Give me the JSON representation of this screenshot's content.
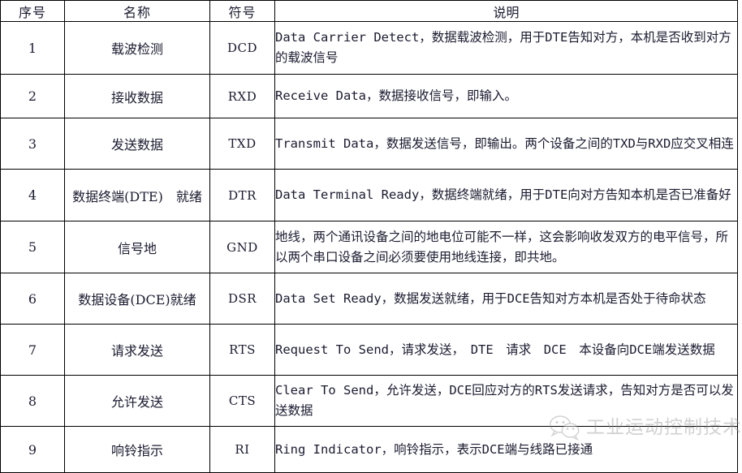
{
  "table": {
    "headers": {
      "seq": "序号",
      "name": "名称",
      "symbol": "符号",
      "description": "说明"
    },
    "rows": [
      {
        "seq": "1",
        "name": "载波检测",
        "symbol": "DCD",
        "description": "Data Carrier Detect，数据载波检测，用于DTE告知对方，本机是否收到对方的载波信号"
      },
      {
        "seq": "2",
        "name": "接收数据",
        "symbol": "RXD",
        "description": "Receive Data，数据接收信号，即输入。"
      },
      {
        "seq": "3",
        "name": "发送数据",
        "symbol": "TXD",
        "description": "Transmit Data，数据发送信号，即输出。两个设备之间的TXD与RXD应交叉相连"
      },
      {
        "seq": "4",
        "name": "数据终端(DTE)　就绪",
        "symbol": "DTR",
        "description": "Data Terminal Ready，数据终端就绪，用于DTE向对方告知本机是否已准备好"
      },
      {
        "seq": "5",
        "name": "信号地",
        "symbol": "GND",
        "description": "地线，两个通讯设备之间的地电位可能不一样，这会影响收发双方的电平信号，所以两个串口设备之间必须要使用地线连接，即共地。"
      },
      {
        "seq": "6",
        "name": "数据设备(DCE)就绪",
        "symbol": "DSR",
        "description": "Data Set Ready，数据发送就绪，用于DCE告知对方本机是否处于待命状态"
      },
      {
        "seq": "7",
        "name": "请求发送",
        "symbol": "RTS",
        "description": "Request To Send，请求发送，　DTE　请求　DCE　本设备向DCE端发送数据"
      },
      {
        "seq": "8",
        "name": "允许发送",
        "symbol": "CTS",
        "description": "Clear To Send，允许发送，DCE回应对方的RTS发送请求，告知对方是否可以发送数据"
      },
      {
        "seq": "9",
        "name": "响铃指示",
        "symbol": "RI",
        "description": "Ring Indicator，响铃指示，表示DCE端与线路已接通"
      }
    ]
  },
  "watermark": {
    "text": "工业运动控制技术",
    "logo_icon": "wechat-icon",
    "color": "#8d8d8d"
  },
  "colors": {
    "border": "#000000",
    "text": "#1b1b30",
    "background": "#ffffff"
  }
}
